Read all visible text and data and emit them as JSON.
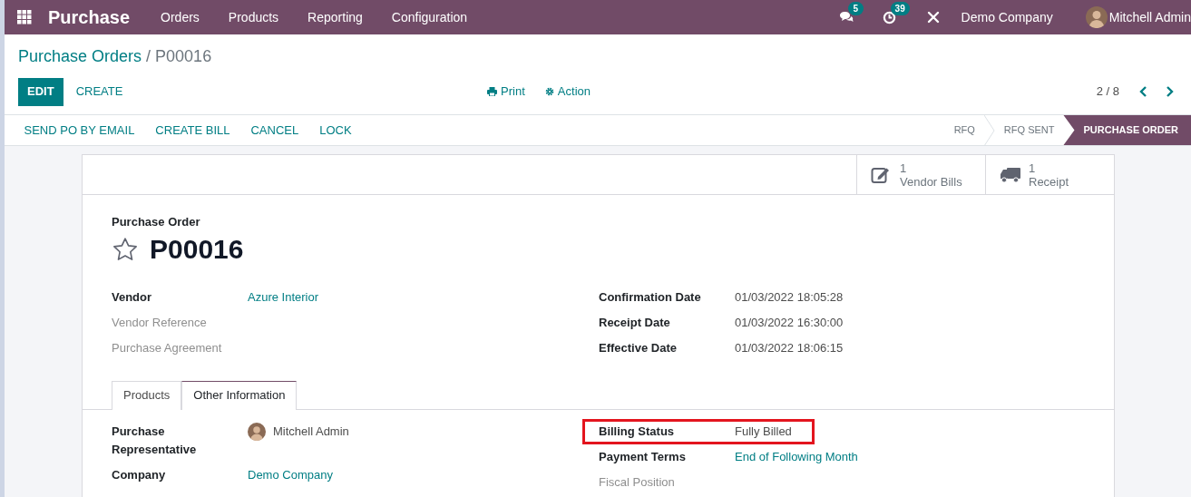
{
  "navbar": {
    "app_name": "Purchase",
    "menu": [
      "Orders",
      "Products",
      "Reporting",
      "Configuration"
    ],
    "messages_count": "5",
    "activities_count": "39",
    "company": "Demo Company",
    "user": "Mitchell Admin"
  },
  "breadcrumb": {
    "parent": "Purchase Orders",
    "separator": "/",
    "current": "P00016"
  },
  "toolbar": {
    "edit": "EDIT",
    "create": "CREATE",
    "print": "Print",
    "action": "Action",
    "pager": "2 / 8"
  },
  "statusbar": {
    "buttons": [
      "SEND PO BY EMAIL",
      "CREATE BILL",
      "CANCEL",
      "LOCK"
    ],
    "stages": [
      {
        "label": "RFQ",
        "selected": false
      },
      {
        "label": "RFQ SENT",
        "selected": false
      },
      {
        "label": "PURCHASE ORDER",
        "selected": true
      }
    ]
  },
  "smart_buttons": [
    {
      "kind": "bills",
      "count": "1",
      "label": "Vendor Bills"
    },
    {
      "kind": "receipt",
      "count": "1",
      "label": "Receipt"
    }
  ],
  "sheet": {
    "subtitle": "Purchase Order",
    "name": "P00016",
    "starred": false,
    "left_fields": [
      {
        "label": "Vendor",
        "muted": false,
        "value": "Azure Interior",
        "kind": "link"
      },
      {
        "label": "Vendor Reference",
        "muted": true
      },
      {
        "label": "Purchase Agreement",
        "muted": true
      }
    ],
    "right_fields": [
      {
        "label": "Confirmation Date",
        "muted": false,
        "value": "01/03/2022 18:05:28",
        "kind": "text"
      },
      {
        "label": "Receipt Date",
        "muted": false,
        "value": "01/03/2022 16:30:00",
        "kind": "text"
      },
      {
        "label": "Effective Date",
        "muted": false,
        "value": "01/03/2022 18:06:15",
        "kind": "text"
      }
    ],
    "tabs": [
      {
        "label": "Products",
        "selected": false
      },
      {
        "label": "Other Information",
        "selected": true
      }
    ],
    "other_left": [
      {
        "label": "Purchase Representative",
        "muted": false,
        "value": "Mitchell Admin",
        "kind": "user"
      },
      {
        "label": "Company",
        "muted": false,
        "value": "Demo Company",
        "kind": "link"
      }
    ],
    "other_right": [
      {
        "label": "Billing Status",
        "muted": false,
        "value": "Fully Billed",
        "kind": "text",
        "highlighted": true
      },
      {
        "label": "Payment Terms",
        "muted": false,
        "value": "End of Following Month",
        "kind": "link",
        "highlighted": false
      },
      {
        "label": "Fiscal Position",
        "muted": true,
        "highlighted": false
      }
    ]
  }
}
